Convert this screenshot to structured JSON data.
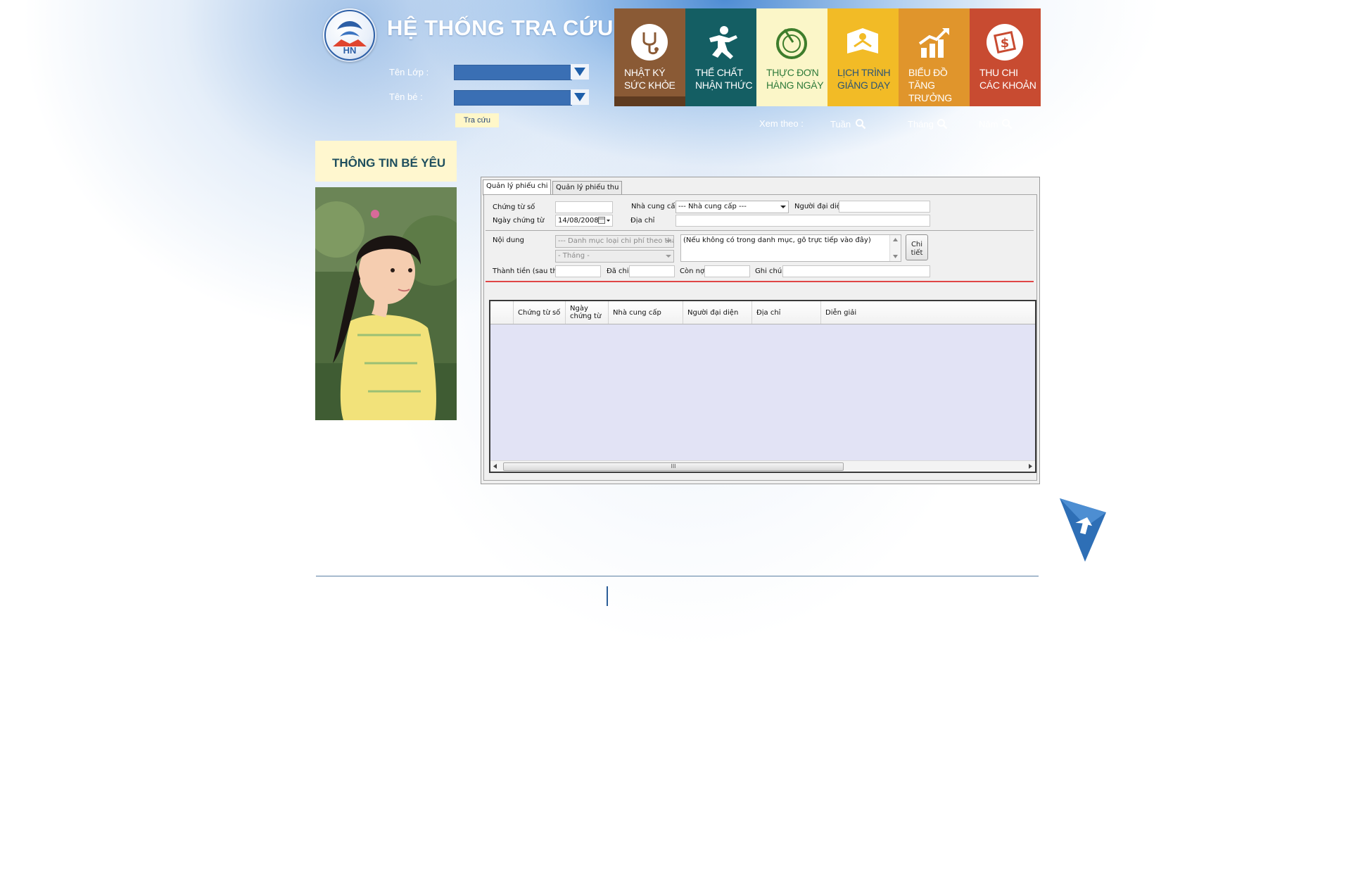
{
  "header": {
    "title": "HỆ THỐNG TRA CỨU",
    "class_label": "Tên Lớp :",
    "child_label": "Tên bé :",
    "search_button": "Tra cứu"
  },
  "nav": {
    "tiles": [
      {
        "label": "NHẬT KÝ\nSỨC KHỎE",
        "color": "#8a5a35",
        "icon": "stethoscope-icon"
      },
      {
        "label": "THỂ CHẤT\nNHẬN THỨC",
        "color": "#145e63",
        "icon": "running-person-icon"
      },
      {
        "label": "THỰC ĐƠN\nHÀNG NGÀY",
        "color": "#fbf6c8",
        "icon": "bowl-whisk-icon"
      },
      {
        "label": "LỊCH TRÌNH\nGIẢNG DẠY",
        "color": "#f2bb26",
        "icon": "teacher-book-icon"
      },
      {
        "label": "BIỂU ĐỒ\nTĂNG TRƯỞNG",
        "color": "#e0952c",
        "icon": "growth-chart-icon"
      },
      {
        "label": "THU CHI\nCÁC KHOẢN",
        "color": "#c84b31",
        "icon": "money-icon"
      }
    ],
    "view_by_label": "Xem theo :",
    "view_options": [
      "Tuần",
      "Tháng",
      "Năm"
    ]
  },
  "sidebar": {
    "heading": "THÔNG TIN BÉ YÊU"
  },
  "app": {
    "tabs": [
      "Quản lý phiếu chi",
      "Quản lý phiếu thu"
    ],
    "form": {
      "voucher_no_label": "Chứng từ số",
      "voucher_no_value": "",
      "supplier_label": "Nhà cung cấp",
      "supplier_value": "--- Nhà cung cấp ---",
      "representative_label": "Người đại diện",
      "representative_value": "",
      "voucher_date_label": "Ngày chứng từ",
      "voucher_date_value": "14/08/2008",
      "address_label": "Địa chỉ",
      "address_value": "",
      "content_label": "Nội dung",
      "category_value": "--- Danh mục loại chi phí theo tháng ---",
      "month_value": "- Tháng -",
      "content_hint": "(Nếu không có trong danh mục, gõ trực tiếp vào đây)",
      "detail_button": "Chi\ntiết",
      "amount_label": "Thành tiền (sau thuế)",
      "paid_label": "Đã chi",
      "debt_label": "Còn nợ",
      "note_label": "Ghi chú"
    },
    "table": {
      "columns": [
        "",
        "Chứng từ số",
        "Ngày chứng từ",
        "Nhà cung cấp",
        "Người đại diện",
        "Địa chỉ",
        "Diễn giải"
      ],
      "rows": [],
      "scroll_thumb": "III"
    }
  }
}
